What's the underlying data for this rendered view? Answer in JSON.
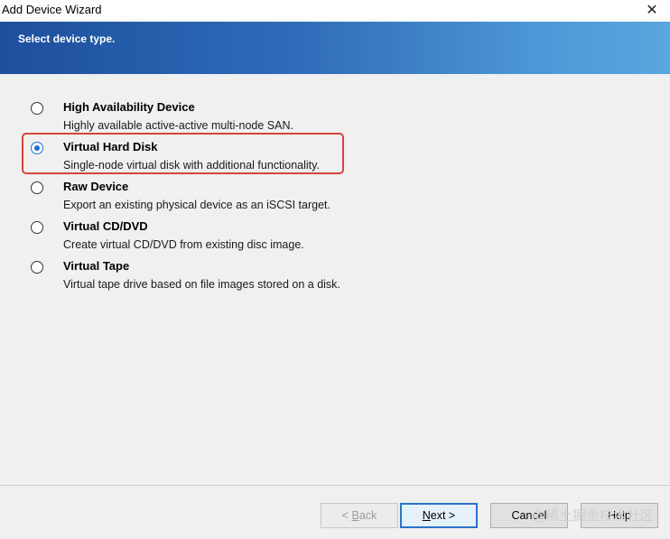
{
  "window": {
    "title": "Add Device Wizard",
    "close_glyph": "✕"
  },
  "banner": {
    "heading": "Select device type."
  },
  "options": [
    {
      "label": "High Availability Device",
      "description": "Highly available active-active multi-node SAN.",
      "selected": false
    },
    {
      "label": "Virtual Hard Disk",
      "description": "Single-node virtual disk with additional functionality.",
      "selected": true
    },
    {
      "label": "Raw Device",
      "description": "Export an existing physical device as an iSCSI target.",
      "selected": false
    },
    {
      "label": "Virtual CD/DVD",
      "description": "Create virtual CD/DVD from existing disc image.",
      "selected": false
    },
    {
      "label": "Virtual Tape",
      "description": "Virtual tape drive based on file images stored on a disk.",
      "selected": false
    }
  ],
  "footer": {
    "back_prefix": "< ",
    "back_mnemonic": "B",
    "back_rest": "ack",
    "next_mnemonic": "N",
    "next_rest": "ext >",
    "cancel_label": "Cancel",
    "help_label": "Help",
    "watermark": "@稀土掘金技术社区"
  },
  "colors": {
    "banner_start": "#1d4f9e",
    "banner_end": "#5aa6de",
    "highlight_border": "#d6453a",
    "radio_selected": "#1f6fd1"
  }
}
